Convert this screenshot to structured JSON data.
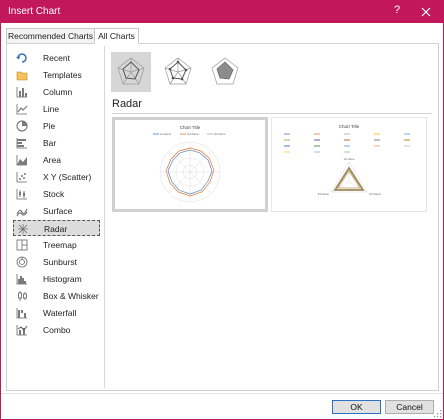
{
  "window": {
    "title": "Insert Chart",
    "help_label": "?"
  },
  "tabs": [
    {
      "label": "Recommended Charts"
    },
    {
      "label": "All Charts"
    }
  ],
  "sidebar": {
    "items": [
      {
        "label": "Recent",
        "icon": "recent-icon"
      },
      {
        "label": "Templates",
        "icon": "templates-icon"
      },
      {
        "label": "Column",
        "icon": "column-chart-icon"
      },
      {
        "label": "Line",
        "icon": "line-chart-icon"
      },
      {
        "label": "Pie",
        "icon": "pie-chart-icon"
      },
      {
        "label": "Bar",
        "icon": "bar-chart-icon"
      },
      {
        "label": "Area",
        "icon": "area-chart-icon"
      },
      {
        "label": "X Y (Scatter)",
        "icon": "scatter-chart-icon"
      },
      {
        "label": "Stock",
        "icon": "stock-chart-icon"
      },
      {
        "label": "Surface",
        "icon": "surface-chart-icon"
      },
      {
        "label": "Radar",
        "icon": "radar-chart-icon",
        "selected": true
      },
      {
        "label": "Treemap",
        "icon": "treemap-chart-icon"
      },
      {
        "label": "Sunburst",
        "icon": "sunburst-chart-icon"
      },
      {
        "label": "Histogram",
        "icon": "histogram-chart-icon"
      },
      {
        "label": "Box & Whisker",
        "icon": "box-whisker-chart-icon"
      },
      {
        "label": "Waterfall",
        "icon": "waterfall-chart-icon"
      },
      {
        "label": "Combo",
        "icon": "combo-chart-icon"
      }
    ]
  },
  "main": {
    "subtypes": [
      {
        "name": "radar",
        "selected": true
      },
      {
        "name": "radar-with-markers",
        "selected": false
      },
      {
        "name": "filled-radar",
        "selected": false
      }
    ],
    "section_title": "Radar",
    "previews": [
      {
        "chart_title": "Chart Title",
        "legend": [
          "1st Name",
          "2nd Name",
          "3rd Name"
        ]
      },
      {
        "chart_title": "Chart Title",
        "axis_labels": [
          "1st Name",
          "2nd Name",
          "3rd Name"
        ]
      }
    ]
  },
  "buttons": {
    "ok": "OK",
    "cancel": "Cancel"
  },
  "colors": {
    "accent": "#c2185b",
    "selected_bg": "#dcdcdc",
    "icon_blue": "#3b6fb6",
    "icon_gray": "#7a7a7a"
  }
}
